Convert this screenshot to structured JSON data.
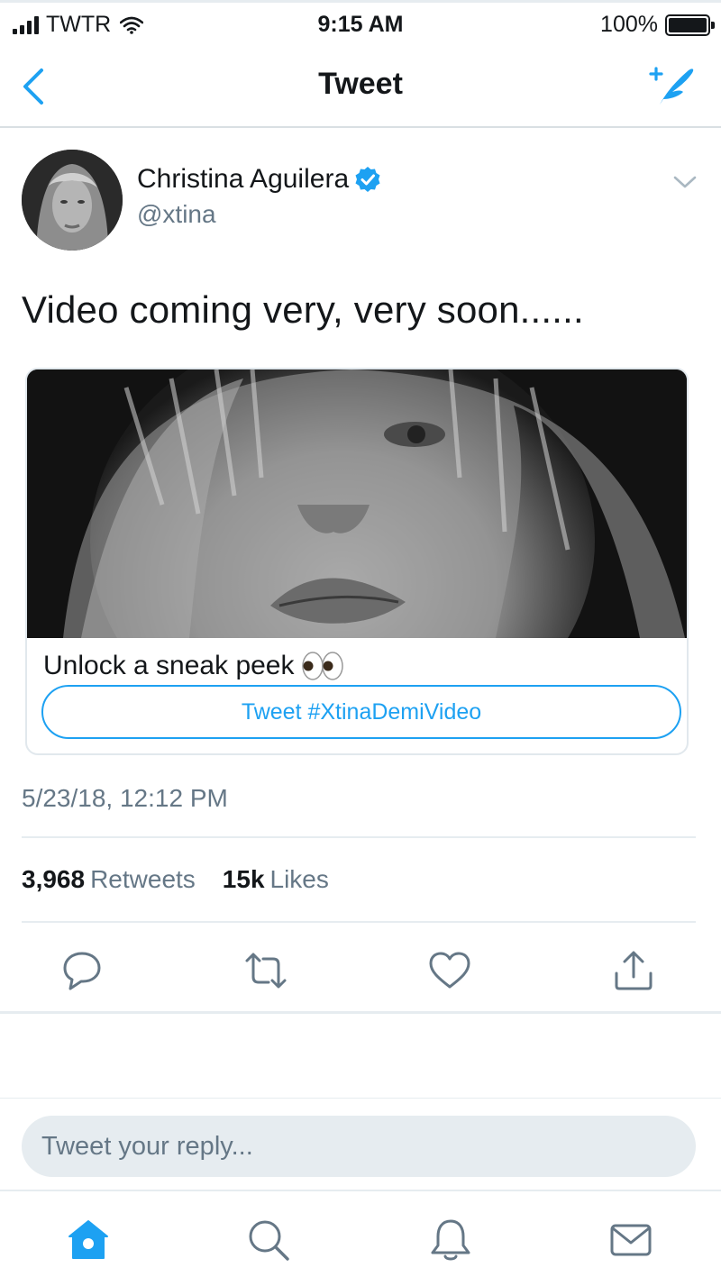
{
  "status_bar": {
    "carrier": "TWTR",
    "time": "9:15 AM",
    "battery": "100%",
    "battery_level": 1.0
  },
  "nav": {
    "title": "Tweet",
    "back_icon": "chevron-left-icon",
    "compose_icon": "compose-tweet-icon"
  },
  "tweet": {
    "author_name": "Christina Aguilera",
    "handle": "@xtina",
    "verified": true,
    "text": "Video coming very, very soon......",
    "timestamp": "5/23/18, 12:12 PM",
    "retweets_count": "3,968",
    "retweets_label": "Retweets",
    "likes_count": "15k",
    "likes_label": "Likes"
  },
  "card": {
    "title": "Unlock a sneak peek",
    "title_emoji": "eyes-emoji",
    "button_label": "Tweet #XtinaDemiVideo"
  },
  "actions": [
    "reply-icon",
    "retweet-icon",
    "like-icon",
    "share-icon"
  ],
  "reply": {
    "placeholder": "Tweet your reply..."
  },
  "tabs": [
    "home-icon",
    "search-icon",
    "notifications-icon",
    "messages-icon"
  ],
  "colors": {
    "accent": "#1da1f2",
    "text": "#14171a",
    "secondary": "#657786",
    "divider": "#e6ecf0"
  }
}
